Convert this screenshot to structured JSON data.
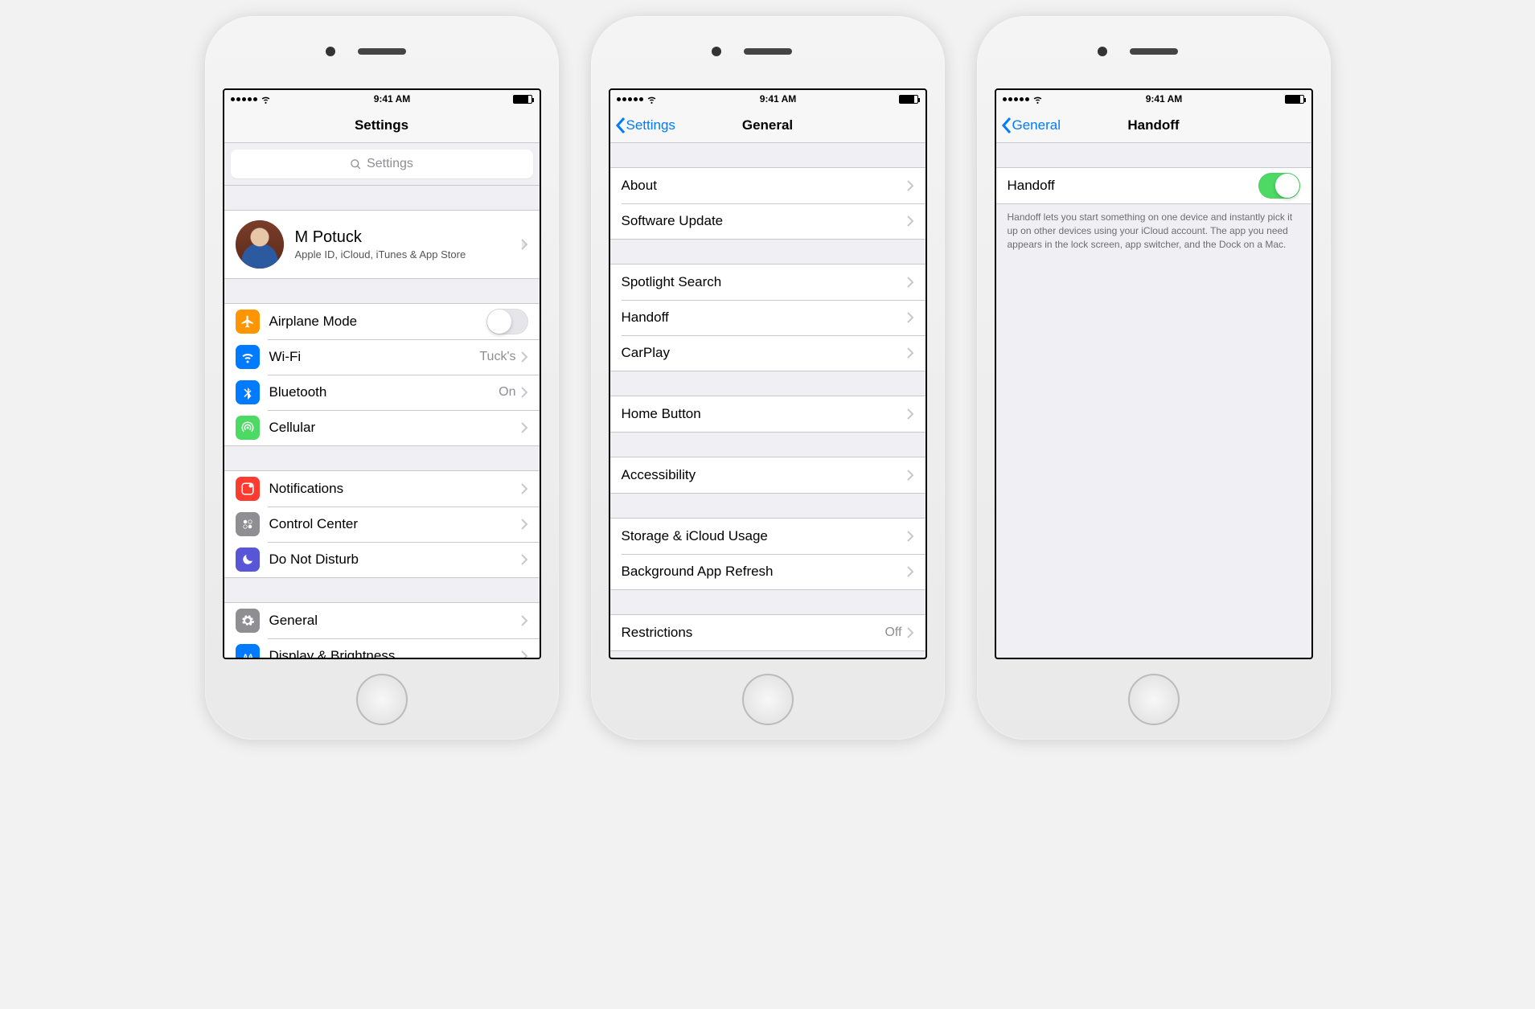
{
  "status": {
    "time": "9:41 AM"
  },
  "phone1": {
    "navTitle": "Settings",
    "searchPlaceholder": "Settings",
    "profile": {
      "name": "M Potuck",
      "sub": "Apple ID, iCloud, iTunes & App Store"
    },
    "g1": {
      "airplane": "Airplane Mode",
      "wifi": "Wi-Fi",
      "wifiDetail": "Tuck's",
      "bluetooth": "Bluetooth",
      "bluetoothDetail": "On",
      "cellular": "Cellular"
    },
    "g2": {
      "notifications": "Notifications",
      "controlCenter": "Control Center",
      "dnd": "Do Not Disturb"
    },
    "g3": {
      "general": "General",
      "display": "Display & Brightness"
    }
  },
  "phone2": {
    "back": "Settings",
    "navTitle": "General",
    "g1": {
      "about": "About",
      "software": "Software Update"
    },
    "g2": {
      "spotlight": "Spotlight Search",
      "handoff": "Handoff",
      "carplay": "CarPlay"
    },
    "g3": {
      "homebutton": "Home Button"
    },
    "g4": {
      "accessibility": "Accessibility"
    },
    "g5": {
      "storage": "Storage & iCloud Usage",
      "background": "Background App Refresh"
    },
    "g6": {
      "restrictions": "Restrictions",
      "restrictionsDetail": "Off"
    }
  },
  "phone3": {
    "back": "General",
    "navTitle": "Handoff",
    "row": "Handoff",
    "footer": "Handoff lets you start something on one device and instantly pick it up on other devices using your iCloud account. The app you need appears in the lock screen, app switcher, and the Dock on a Mac."
  }
}
